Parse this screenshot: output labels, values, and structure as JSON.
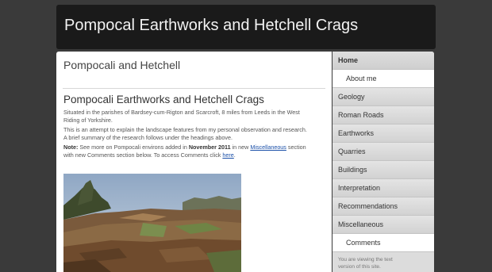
{
  "header": {
    "site_title": "Pompocal Earthworks and Hetchell Crags"
  },
  "main": {
    "section_title": "Pompocali and Hetchell",
    "article_title": "Pompocali Earthworks and Hetchell Crags",
    "para1_line1": "Situated in the parishes of Bardsey-cum-Rigton and Scarcroft, 8 miles from Leeds in the West",
    "para1_line2": "Riding of Yorkshire.",
    "para2_line1": "This is an attempt to explain the landscape features from my personal observation and research.",
    "para2_line2": "A brief summary of the research follows under the headings above.",
    "note_label": "Note:",
    "note_text1": " See more on Pompocali environs added in ",
    "note_date": "November 2011",
    "note_text2": " in new ",
    "note_link1": "Miscellaneous",
    "note_text3": " section",
    "note_text4": "with new Comments section below. To access Comments click ",
    "note_link2": "here",
    "note_text5": "."
  },
  "sidebar": {
    "items": [
      {
        "label": "Home"
      },
      {
        "label": "About me"
      },
      {
        "label": "Geology"
      },
      {
        "label": "Roman Roads"
      },
      {
        "label": "Earthworks"
      },
      {
        "label": "Quarries"
      },
      {
        "label": "Buildings"
      },
      {
        "label": "Interpretation"
      },
      {
        "label": "Recommendations"
      },
      {
        "label": "Miscellaneous"
      },
      {
        "label": "Comments"
      }
    ],
    "note_line1": "You are viewing the text",
    "note_line2": "version of this site."
  }
}
